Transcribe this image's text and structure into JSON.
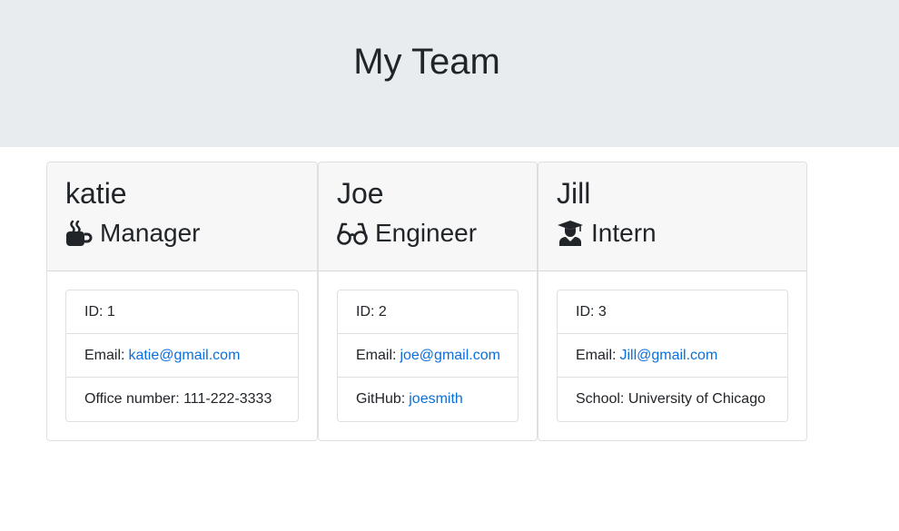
{
  "header": {
    "title": "My Team"
  },
  "colors": {
    "jumbotron": "#e9ecef",
    "card_header": "#f7f7f7",
    "link": "#0a6fdc",
    "text": "#212529"
  },
  "team": [
    {
      "name": "katie",
      "role": "Manager",
      "role_icon": "mug-hot-icon",
      "id_text": "ID: 1",
      "email_label": "Email:",
      "email": "katie@gmail.com",
      "extra_text": "Office number: 111-222-3333"
    },
    {
      "name": "Joe",
      "role": "Engineer",
      "role_icon": "glasses-icon",
      "id_text": "ID: 2",
      "email_label": "Email:",
      "email": "joe@gmail.com",
      "extra_label": "GitHub:",
      "github": "joesmith"
    },
    {
      "name": "Jill",
      "role": "Intern",
      "role_icon": "graduate-icon",
      "id_text": "ID: 3",
      "email_label": "Email:",
      "email": "Jill@gmail.com",
      "extra_text": "School: University of Chicago"
    }
  ]
}
